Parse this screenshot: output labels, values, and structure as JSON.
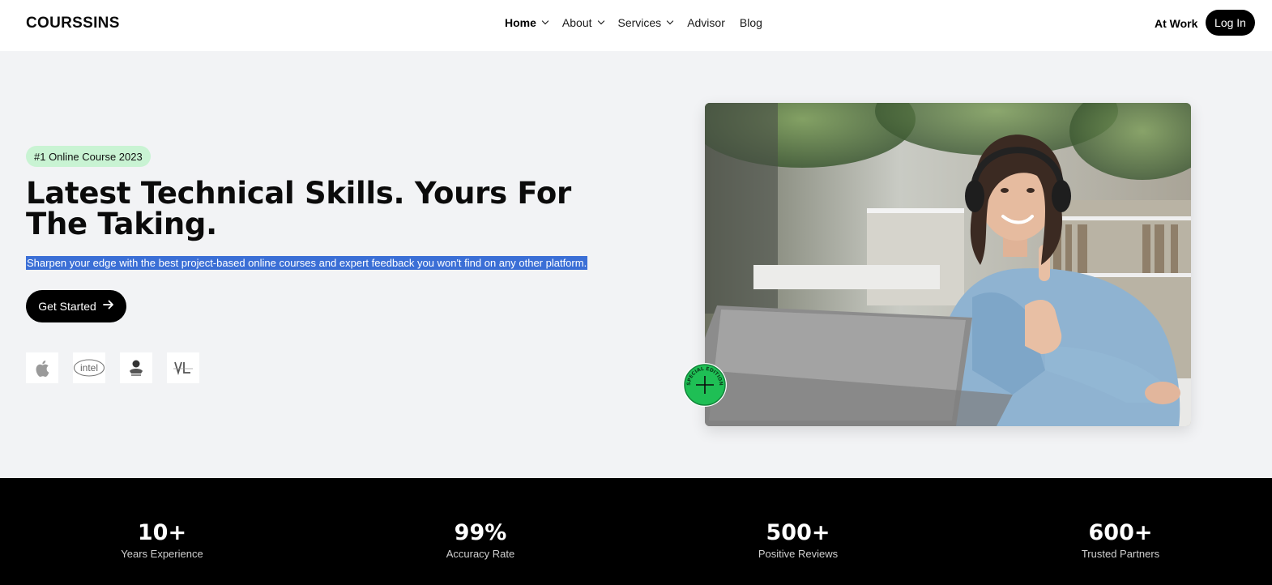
{
  "header": {
    "logo": "COURSSINS",
    "nav": [
      {
        "label": "Home",
        "has_dropdown": true,
        "active": true
      },
      {
        "label": "About",
        "has_dropdown": true,
        "active": false
      },
      {
        "label": "Services",
        "has_dropdown": true,
        "active": false
      },
      {
        "label": "Advisor",
        "has_dropdown": false,
        "active": false
      },
      {
        "label": "Blog",
        "has_dropdown": false,
        "active": false
      }
    ],
    "at_work": "At Work",
    "login": "Log In"
  },
  "hero": {
    "badge": "#1 Online Course 2023",
    "title": "Latest Technical Skills. Yours For The Taking.",
    "subtitle": "Sharpen your edge with the best project-based online courses and expert feedback you won't find on any other platform.",
    "cta": "Get Started",
    "partners": [
      "apple-icon",
      "intel-logo",
      "club-logo",
      "vl-logo"
    ],
    "seal_text": "SPECIAL EDITION"
  },
  "stats": [
    {
      "value": "10+",
      "label": "Years Experience"
    },
    {
      "value": "99%",
      "label": "Accuracy Rate"
    },
    {
      "value": "500+",
      "label": "Positive Reviews"
    },
    {
      "value": "600+",
      "label": "Trusted Partners"
    }
  ],
  "colors": {
    "accent": "#000000",
    "badge_bg": "#c9f3d3",
    "highlight": "#3b6fd6",
    "seal": "#1fbf55",
    "page_bg": "#f2f3f5"
  }
}
